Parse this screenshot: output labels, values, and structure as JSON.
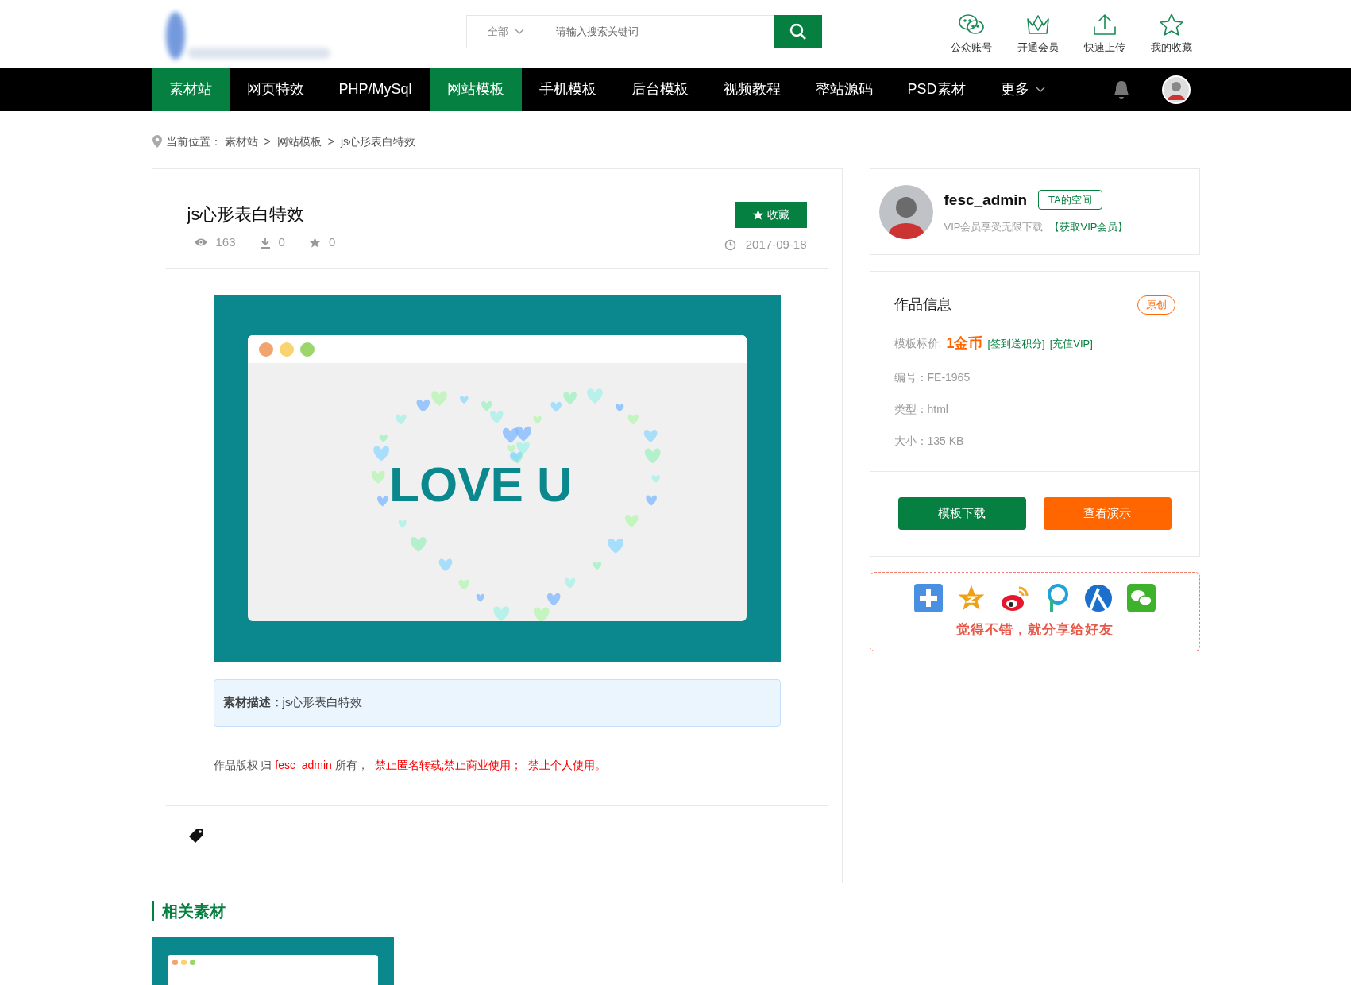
{
  "header": {
    "search": {
      "scope": "全部",
      "placeholder": "请输入搜索关键词"
    },
    "quick_links": [
      {
        "kind": "chat",
        "label": "公众账号"
      },
      {
        "kind": "crown",
        "label": "开通会员"
      },
      {
        "kind": "upload",
        "label": "快速上传"
      },
      {
        "kind": "star",
        "label": "我的收藏"
      }
    ]
  },
  "nav": {
    "items": [
      {
        "label": "素材站",
        "selected": true
      },
      {
        "label": "网页特效",
        "selected": false
      },
      {
        "label": "PHP/MySql",
        "selected": false
      },
      {
        "label": "网站模板",
        "selected": true
      },
      {
        "label": "手机模板",
        "selected": false
      },
      {
        "label": "后台模板",
        "selected": false
      },
      {
        "label": "视频教程",
        "selected": false
      },
      {
        "label": "整站源码",
        "selected": false
      },
      {
        "label": "PSD素材",
        "selected": false
      }
    ],
    "more": "更多"
  },
  "breadcrumb": {
    "label": "当前位置：",
    "parts": [
      {
        "kind": "link",
        "text": "素材站"
      },
      {
        "kind": "sep",
        "text": ">"
      },
      {
        "kind": "link",
        "text": "网站模板"
      },
      {
        "kind": "sep",
        "text": ">"
      },
      {
        "kind": "link",
        "text": "js心形表白特效"
      }
    ]
  },
  "article": {
    "title": "js心形表白特效",
    "favorite_button": "收藏",
    "stats": [
      {
        "kind": "views",
        "value": "163"
      },
      {
        "kind": "downloads",
        "value": "0"
      },
      {
        "kind": "stars",
        "value": "0"
      }
    ],
    "date": "2017-09-18",
    "preview": {
      "text": "LOVE U"
    },
    "description": {
      "label": "素材描述：",
      "text": "js心形表白特效"
    },
    "copyright": [
      {
        "kind": "plain",
        "text": "作品版权 归 "
      },
      {
        "kind": "red",
        "text": "fesc_admin"
      },
      {
        "kind": "plain",
        "text": " 所有，  "
      },
      {
        "kind": "red",
        "text": "禁止匿名转载;禁止商业使用；  禁止个人使用。"
      }
    ]
  },
  "author": {
    "name": "fesc_admin",
    "space_button": "TA的空间",
    "vip_note": "VIP会员享受无限下载",
    "vip_link": "【获取VIP会员】"
  },
  "info": {
    "title": "作品信息",
    "badge": "原创",
    "price_label": "模板标价:",
    "price": "1金币",
    "price_links": [
      "[签到送积分]",
      "[充值VIP]"
    ],
    "fields": [
      {
        "label": "编号：",
        "value": "FE-1965"
      },
      {
        "label": "类型：",
        "value": "html"
      },
      {
        "label": "大小：",
        "value": "135 KB"
      }
    ],
    "buttons": [
      {
        "kind": "download",
        "label": "模板下载"
      },
      {
        "kind": "demo",
        "label": "查看演示"
      }
    ]
  },
  "share": {
    "icons": [
      {
        "kind": "plus"
      },
      {
        "kind": "star"
      },
      {
        "kind": "eye"
      },
      {
        "kind": "pin"
      },
      {
        "kind": "person"
      },
      {
        "kind": "chat"
      }
    ],
    "slogan": "觉得不错，就分享给好友"
  },
  "related": {
    "heading": "相关素材"
  }
}
